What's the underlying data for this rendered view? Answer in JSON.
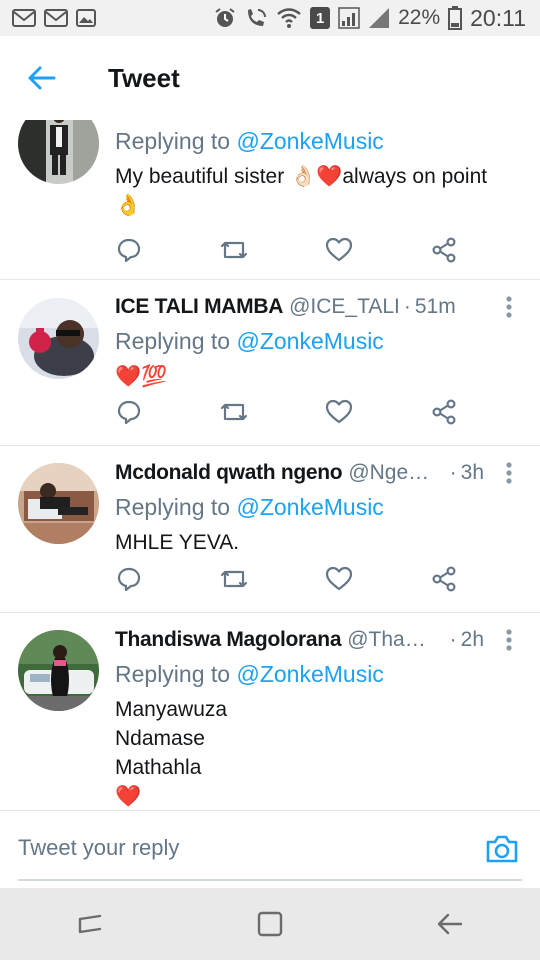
{
  "status_bar": {
    "battery_percent": "22%",
    "time": "20:11",
    "sim_badge": "1",
    "icons": [
      "gmail-icon",
      "gmail-icon",
      "image-icon",
      "alarm-icon",
      "volte-call-icon",
      "wifi-icon",
      "sim-icon",
      "signal-icon",
      "battery-icon"
    ]
  },
  "header": {
    "title": "Tweet",
    "back_icon": "arrow-left-icon"
  },
  "tweets": [
    {
      "name": "",
      "handle": "",
      "time": "",
      "replying_prefix": "Replying to ",
      "replying_handle": "@ZonkeMusic",
      "text_lines": [
        "My beautiful sister 👌🏻❤️always on point",
        "👌"
      ]
    },
    {
      "name": "ICE TALI MAMBA",
      "handle": "@ICE_TALI",
      "time": "51m",
      "replying_prefix": "Replying to ",
      "replying_handle": "@ZonkeMusic",
      "text_lines": [
        "❤️💯"
      ]
    },
    {
      "name": "Mcdonald qwath ngeno",
      "handle": "@Ngen...",
      "time": "3h",
      "replying_prefix": "Replying to ",
      "replying_handle": "@ZonkeMusic",
      "text_lines": [
        "MHLE YEVA."
      ]
    },
    {
      "name": "Thandiswa Magolorana",
      "handle": "@Than...",
      "time": "2h",
      "replying_prefix": "Replying to ",
      "replying_handle": "@ZonkeMusic",
      "text_lines": [
        "Manyawuza",
        "Ndamase",
        "Mathahla",
        "❤️"
      ]
    }
  ],
  "actions": {
    "reply_icon": "reply-icon",
    "retweet_icon": "retweet-icon",
    "like_icon": "heart-icon",
    "share_icon": "share-icon",
    "more_icon": "more-vertical-icon"
  },
  "composer": {
    "placeholder": "Tweet your reply",
    "camera_icon": "camera-icon"
  },
  "nav": {
    "recents_icon": "recents-icon",
    "home_icon": "home-icon",
    "back_icon": "back-icon"
  },
  "colors": {
    "accent": "#1da1f2",
    "text": "#14171a",
    "secondary": "#657786",
    "divider": "#e1e8ed",
    "heart": "#e0245e"
  }
}
